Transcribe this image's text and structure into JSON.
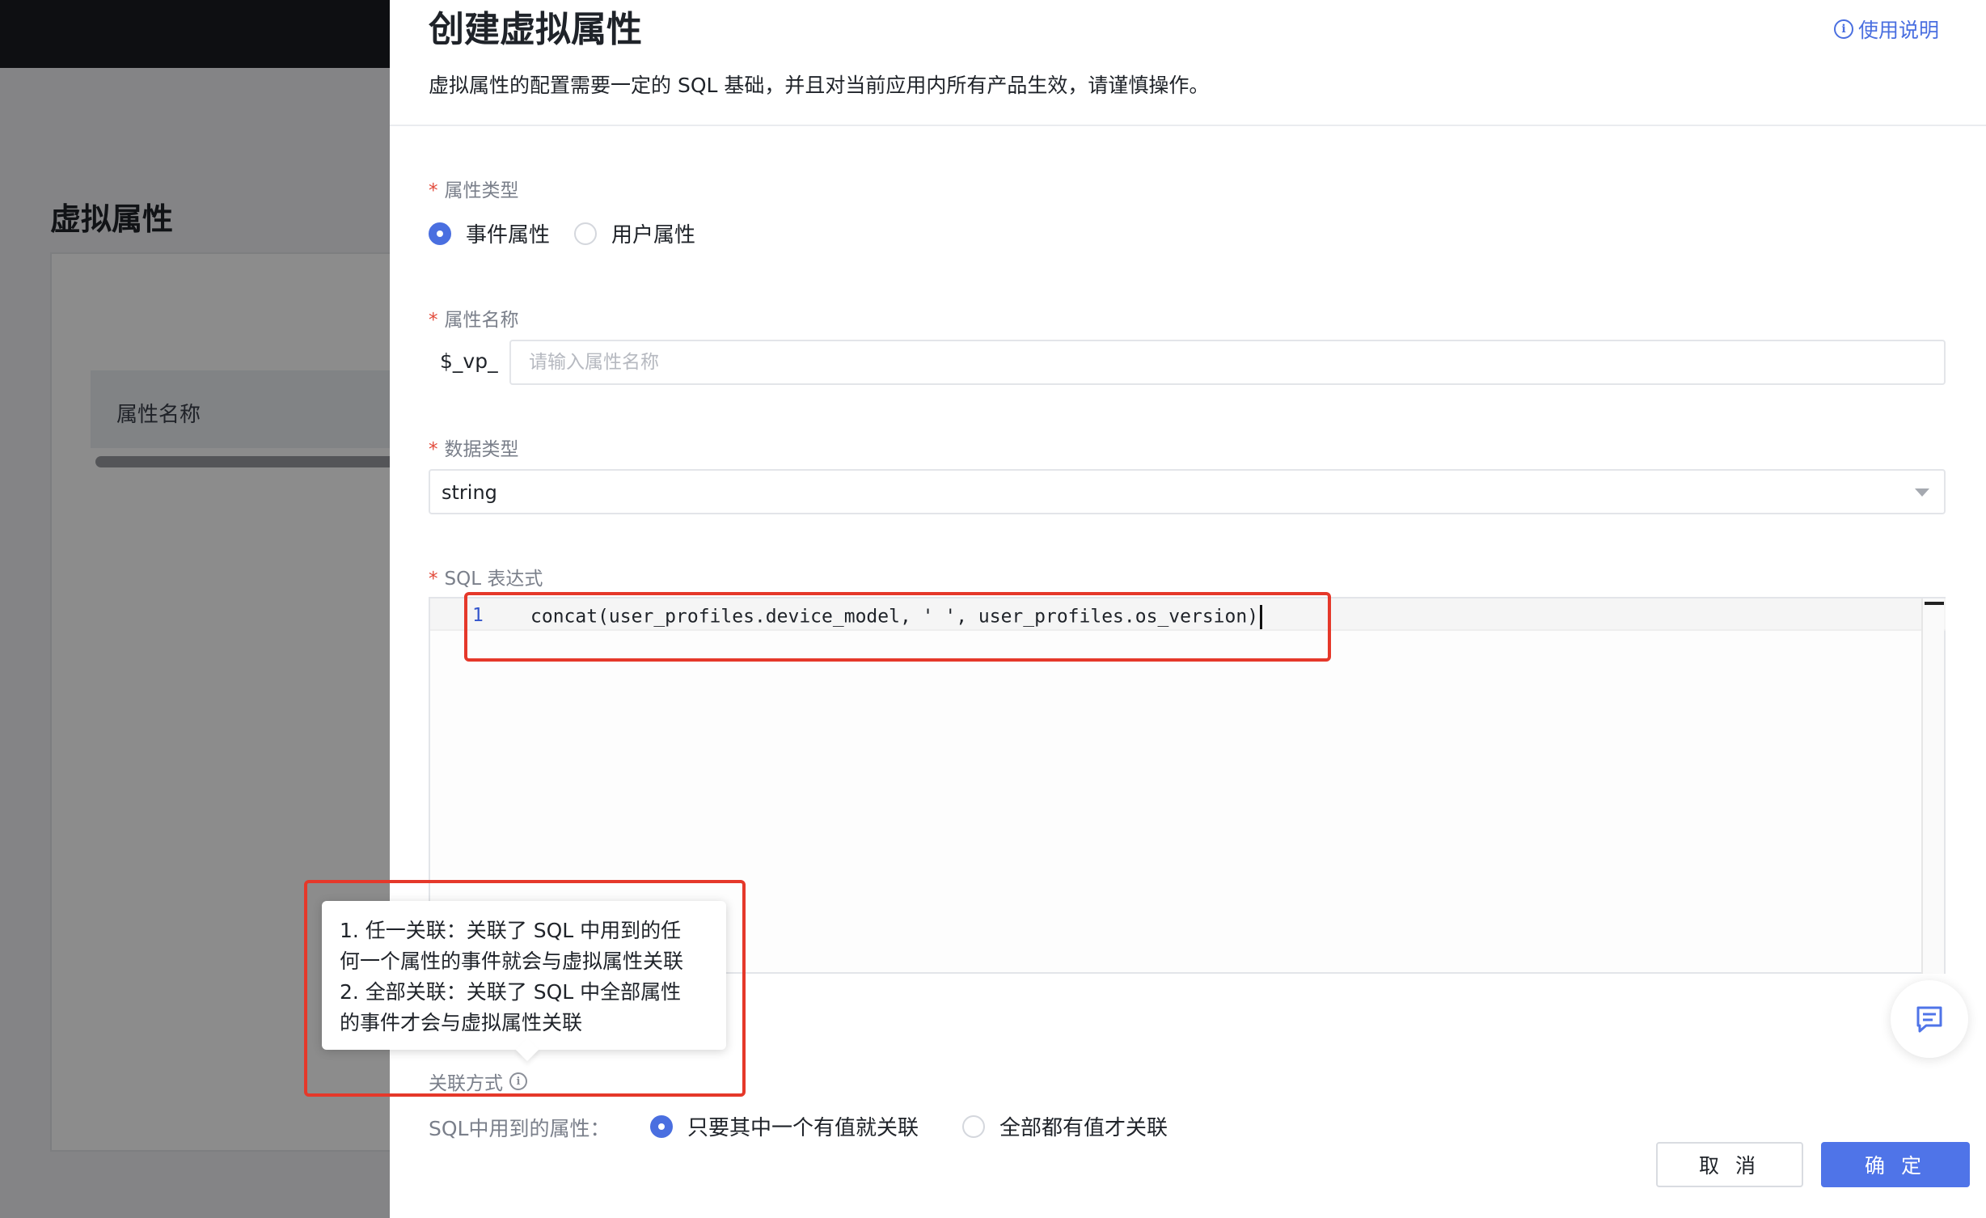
{
  "background": {
    "page_title": "虚拟属性",
    "table_header": "属性名称"
  },
  "drawer": {
    "title": "创建虚拟属性",
    "help_link": "使用说明",
    "description": "虚拟属性的配置需要一定的 SQL 基础，并且对当前应用内所有产品生效，请谨慎操作。"
  },
  "form": {
    "required_mark": "*",
    "attr_type": {
      "label": "属性类型",
      "options": [
        {
          "label": "事件属性",
          "checked": true
        },
        {
          "label": "用户属性",
          "checked": false
        }
      ]
    },
    "attr_name": {
      "label": "属性名称",
      "prefix": "$_vp_",
      "placeholder": "请输入属性名称",
      "value": ""
    },
    "data_type": {
      "label": "数据类型",
      "value": "string"
    },
    "sql": {
      "label": "SQL 表达式",
      "line_number": "1",
      "code": "concat(user_profiles.device_model, ' ', user_profiles.os_version)"
    },
    "association": {
      "label": "关联方式",
      "sql_attr_label": "SQL中用到的属性：",
      "options": [
        {
          "label": "只要其中一个有值就关联",
          "checked": true
        },
        {
          "label": "全部都有值才关联",
          "checked": false
        }
      ],
      "tooltip_lines": [
        "1. 任一关联：关联了 SQL 中用到的任",
        "何一个属性的事件就会与虚拟属性关联",
        "2. 全部关联：关联了 SQL 中全部属性",
        "的事件才会与虚拟属性关联"
      ]
    }
  },
  "footer": {
    "cancel": "取 消",
    "ok": "确 定"
  },
  "icons": {
    "info": "info-icon",
    "feedback": "message-icon",
    "dropdown": "chevron-down-icon"
  },
  "colors": {
    "primary": "#4f74e8",
    "highlight": "#e5382a",
    "required": "#e24a3a"
  }
}
